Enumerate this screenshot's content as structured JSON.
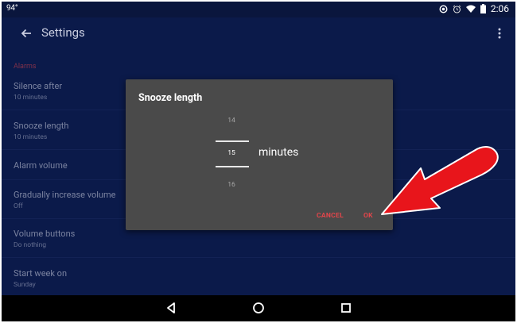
{
  "status_bar": {
    "left_text": "94°",
    "time": "2:06",
    "icons": [
      "alarm-active-icon",
      "alarm-clock-icon",
      "wifi-icon",
      "battery-icon"
    ]
  },
  "app_bar": {
    "title": "Settings",
    "back_icon": "arrow-back-icon",
    "menu_icon": "more-vert-icon"
  },
  "settings": {
    "section_header": "Alarms",
    "items": [
      {
        "title": "Silence after",
        "subtitle": "10 minutes"
      },
      {
        "title": "Snooze length",
        "subtitle": "10 minutes"
      },
      {
        "title": "Alarm volume",
        "subtitle": ""
      },
      {
        "title": "Gradually increase volume",
        "subtitle": "Off"
      },
      {
        "title": "Volume buttons",
        "subtitle": "Do nothing"
      },
      {
        "title": "Start week on",
        "subtitle": "Sunday"
      }
    ]
  },
  "dialog": {
    "title": "Snooze length",
    "picker": {
      "previous": "14",
      "selected": "15",
      "next": "16",
      "unit": "minutes"
    },
    "cancel_label": "CANCEL",
    "ok_label": "OK"
  },
  "colors": {
    "background": "#0b1a4a",
    "accent": "#e3454a",
    "dialog": "#4a4a4a",
    "annotation_arrow": "#e8151b"
  },
  "nav_bar": {
    "icons": [
      "back-triangle-icon",
      "home-circle-icon",
      "recents-square-icon"
    ]
  }
}
